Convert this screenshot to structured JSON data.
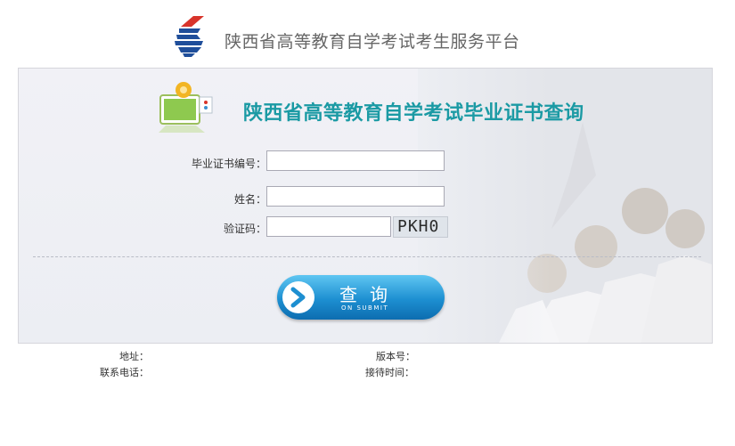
{
  "header": {
    "site_title": "陕西省高等教育自学考试考生服务平台"
  },
  "form": {
    "title": "陕西省高等教育自学考试毕业证书查询",
    "certificate_label": "毕业证书编号：",
    "certificate_value": "",
    "name_label": "姓名：",
    "name_value": "",
    "captcha_label": "验证码：",
    "captcha_value": "",
    "captcha_text": "PKH0"
  },
  "submit": {
    "label": "查询",
    "sublabel": "ON SUBMIT"
  },
  "footer": {
    "address_label": "地址：",
    "phone_label": "联系电话：",
    "version_label": "版本号：",
    "hours_label": "接待时间："
  },
  "colors": {
    "title_accent": "#1b9aa4",
    "button_blue": "#1d8fd1",
    "panel_bg": "#eceef3"
  },
  "icons": {
    "logo": "exam-logo-icon",
    "computer": "computer-illustration-icon",
    "arrow": "arrow-right-icon"
  }
}
